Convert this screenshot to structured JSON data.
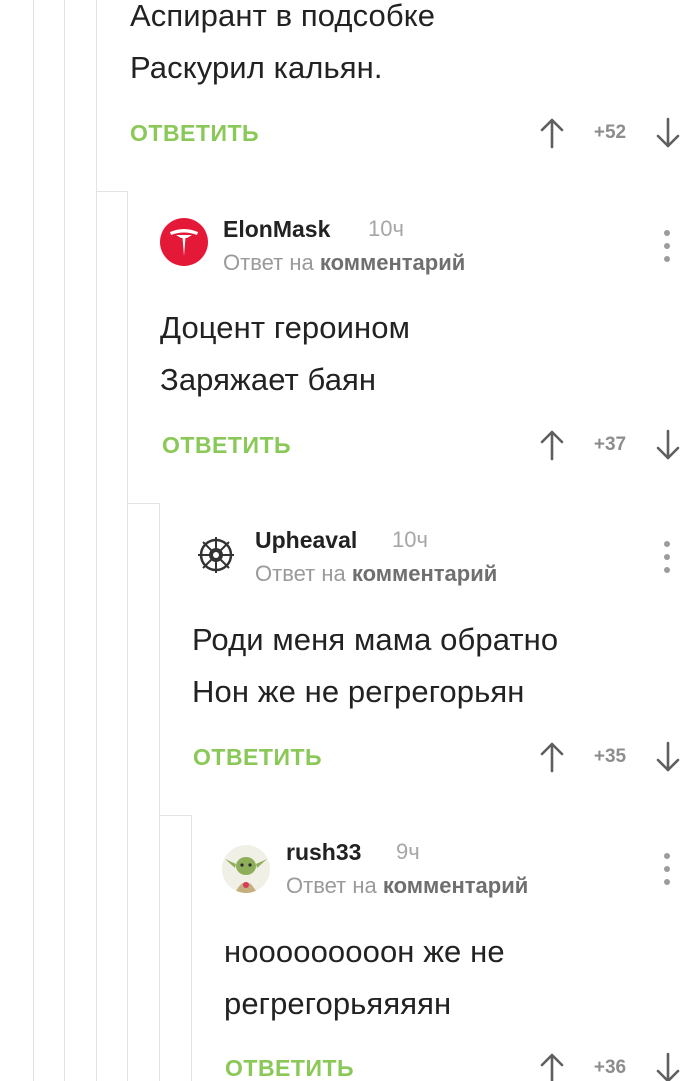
{
  "common": {
    "reply_label": "ОТВЕТИТЬ",
    "reply_to_prefix": "Ответ на",
    "reply_to_link": "комментарий"
  },
  "comments": [
    {
      "lines": [
        "Аспирант в подсобке",
        "Раскурил кальян."
      ],
      "score": "+52"
    },
    {
      "username": "ElonMask",
      "time": "10ч",
      "avatar_icon": "tesla-logo-icon",
      "lines": [
        "Доцент героином",
        "Заряжает баян"
      ],
      "score": "+37"
    },
    {
      "username": "Upheaval",
      "time": "10ч",
      "avatar_icon": "emblem-icon",
      "lines": [
        "Роди меня мама обратно",
        "Нон же не регрегорьян"
      ],
      "score": "+35"
    },
    {
      "username": "rush33",
      "time": "9ч",
      "avatar_icon": "yoda-icon",
      "lines": [
        "нооооооооон же не",
        "регрегорьяяяян"
      ],
      "score": "+36"
    }
  ],
  "colors": {
    "reply_green": "#8ac858",
    "text": "#222222",
    "muted": "#9a9a9a",
    "tesla_red": "#e31937"
  }
}
